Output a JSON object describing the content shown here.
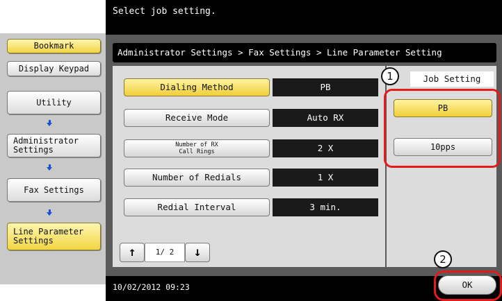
{
  "message": "Select job setting.",
  "left_panel": {
    "bookmark_label": "Bookmark",
    "display_keypad_label": "Display Keypad",
    "nav": [
      {
        "label": "Utility"
      },
      {
        "label_line1": "Administrator",
        "label_line2": "Settings"
      },
      {
        "label": "Fax Settings"
      },
      {
        "label_line1": "Line Parameter",
        "label_line2": "Settings"
      }
    ]
  },
  "breadcrumb": "Administrator Settings  > Fax Settings  > Line Parameter Setting",
  "settings": [
    {
      "label": "Dialing Method",
      "value": "PB"
    },
    {
      "label": "Receive Mode",
      "value": "Auto RX"
    },
    {
      "label_line1": "Number of RX",
      "label_line2": "Call Rings",
      "value": "2  X"
    },
    {
      "label": "Number of Redials",
      "value": "1  X"
    },
    {
      "label": "Redial Interval",
      "value": "3  min."
    }
  ],
  "pager": {
    "up_icon": "↑",
    "text": "1/ 2",
    "down_icon": "↓"
  },
  "job_setting": {
    "title": "Job Setting",
    "options": [
      {
        "label": "PB",
        "selected": true
      },
      {
        "label": "10pps",
        "selected": false
      }
    ]
  },
  "callouts": {
    "one": "1",
    "two": "2"
  },
  "footer": {
    "datetime": "10/02/2012   09:23",
    "ok_label": "OK"
  },
  "colors": {
    "highlight_red": "#e31b1b",
    "selected_yellow": "#f1cf3a",
    "arrow_blue": "#1a4fd6"
  }
}
